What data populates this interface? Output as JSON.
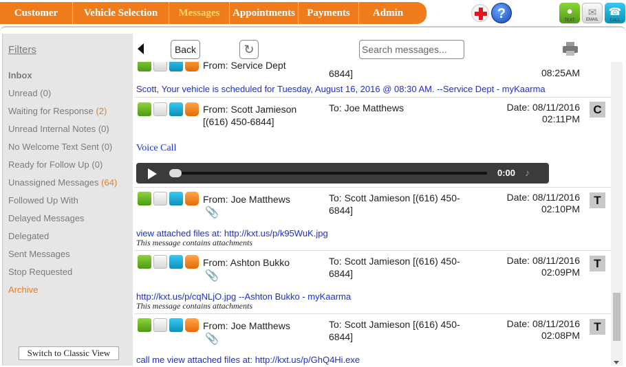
{
  "nav": {
    "tabs": [
      {
        "label": "Customer",
        "active": false
      },
      {
        "label": "Vehicle Selection",
        "active": false
      },
      {
        "label": "Messages",
        "active": true
      },
      {
        "label": "Appointments",
        "active": false
      },
      {
        "label": "Payments",
        "active": false
      },
      {
        "label": "Admin",
        "active": false
      }
    ],
    "help_label": "?",
    "icons": {
      "text_label": "TEXT",
      "email_label": "EMAIL",
      "call_label": "CALL"
    }
  },
  "sidebar": {
    "title": "Filters",
    "items": [
      {
        "label": "Inbox",
        "count": ""
      },
      {
        "label": "Unread",
        "count": "(0)"
      },
      {
        "label": "Waiting for Response",
        "count": "(2)"
      },
      {
        "label": "Unread Internal Notes",
        "count": "(0)"
      },
      {
        "label": "No Welcome Text Sent",
        "count": "(0)"
      },
      {
        "label": "Ready for Follow Up",
        "count": "(0)"
      },
      {
        "label": "Unassigned Messages",
        "count": "(64)"
      },
      {
        "label": "Followed Up With",
        "count": ""
      },
      {
        "label": "Delayed Messages",
        "count": ""
      },
      {
        "label": "Delegated",
        "count": ""
      },
      {
        "label": "Sent Messages",
        "count": ""
      },
      {
        "label": "Stop Requested",
        "count": ""
      },
      {
        "label": "Archive",
        "count": ""
      }
    ],
    "classic_view": "Switch to Classic View"
  },
  "toolbar": {
    "back": "Back",
    "search_placeholder": "Search messages..."
  },
  "messages": {
    "partial": {
      "from": "From: Service Dept",
      "to_tail": "6844]",
      "time": "08:25AM",
      "body": "Scott, Your vehicle is scheduled for Tuesday, August 16, 2016 @ 08:30 AM. --Service Dept - myKaarma"
    },
    "m1": {
      "from": "From: Scott Jamieson",
      "from2": "[(616) 450-6844]",
      "to": "To: Joe Matthews",
      "date": "Date: 08/11/2016",
      "time": "02:11PM",
      "badge": "C",
      "body": "Voice Call",
      "audio_time": "0:00"
    },
    "m2": {
      "from": "From: Joe Matthews",
      "to": "To: Scott Jamieson [(616) 450-",
      "to2": "6844]",
      "date": "Date: 08/11/2016",
      "time": "02:10PM",
      "badge": "T",
      "body": "view attached files at: http://kxt.us/p/k95WuK.jpg",
      "note": "This message contains attachments"
    },
    "m3": {
      "from": "From: Ashton Bukko",
      "to": "To: Scott Jamieson [(616) 450-",
      "to2": "6844]",
      "date": "Date: 08/11/2016",
      "time": "02:09PM",
      "badge": "T",
      "body": "http://kxt.us/p/cqNLjO.jpg --Ashton Bukko - myKaarma",
      "note": "This message contains attachments"
    },
    "m4": {
      "from": "From: Joe Matthews",
      "to": "To: Scott Jamieson [(616) 450-",
      "to2": "6844]",
      "date": "Date: 08/11/2016",
      "time": "02:08PM",
      "badge": "T",
      "body": "call me  view attached files at: http://kxt.us/p/GhQ4Hi.exe"
    }
  }
}
